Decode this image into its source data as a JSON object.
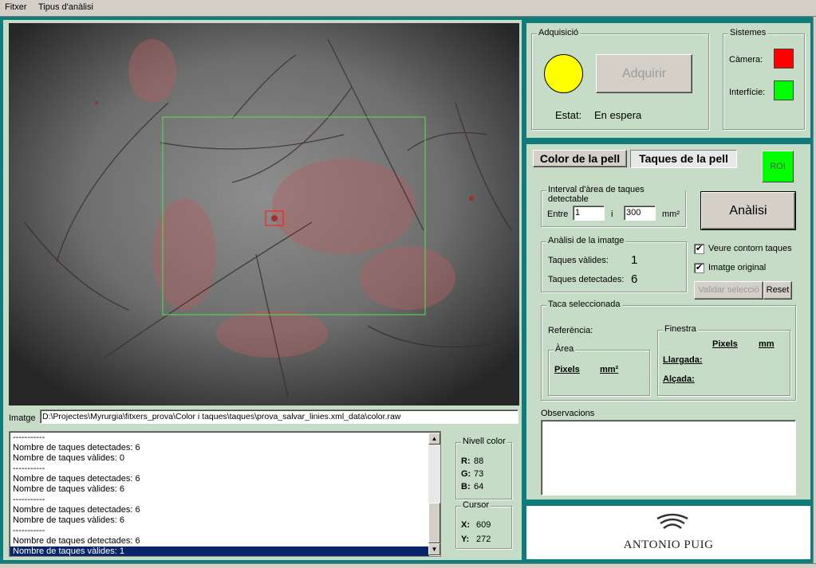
{
  "menu": {
    "file": "Fitxer",
    "analysis": "Tipus d'anàlisi"
  },
  "image_path_label": "Imatge",
  "image_path": "D:\\Projectes\\Myrurgia\\fitxers_prova\\Color i taques\\taques\\prova_salvar_linies.xml_data\\color.raw",
  "log": [
    "-----------",
    "Nombre de taques detectades: 6",
    "Nombre de taques vàlides: 0",
    "-----------",
    "Nombre de taques detectades: 6",
    "Nombre de taques vàlides: 6",
    "-----------",
    "Nombre de taques detectades: 6",
    "Nombre de taques vàlides: 6",
    "-----------",
    "Nombre de taques detectades: 6",
    "Nombre de taques vàlides: 1"
  ],
  "color_level": {
    "title": "Nivell color",
    "r_label": "R:",
    "r": "88",
    "g_label": "G:",
    "g": "73",
    "b_label": "B:",
    "b": "64"
  },
  "cursor": {
    "title": "Cursor",
    "x_label": "X:",
    "x": "609",
    "y_label": "Y:",
    "y": "272"
  },
  "acquisition": {
    "title": "Adquisició",
    "button": "Adquirir",
    "state_label": "Estat:",
    "state": "En espera",
    "indicator_color": "#ffff00"
  },
  "systems": {
    "title": "Sistemes",
    "camera": "Càmera:",
    "camera_color": "#ff0000",
    "interface": "Interfície:",
    "interface_color": "#00ff00"
  },
  "tabs": {
    "skin_color": "Color de la pell",
    "skin_spots": "Taques de la pell"
  },
  "roi_button": "ROI",
  "interval": {
    "title": "Interval d'àrea de taques detectable",
    "between": "Entre",
    "and": "i",
    "min": "1",
    "max": "300",
    "unit": "mm²"
  },
  "analyze_button": "Anàlisi",
  "image_analysis": {
    "title": "Anàlisi de la imatge",
    "valid_label": "Taques vàlides:",
    "valid": "1",
    "detected_label": "Taques detectades:",
    "detected": "6"
  },
  "options": {
    "show_contour": "Veure contorn taques",
    "original_image": "Imatge original"
  },
  "validate_button": "Validar selecció",
  "reset_button": "Reset",
  "selected_spot": {
    "title": "Taca seleccionada",
    "reference": "Referència:",
    "area_title": "Àrea",
    "pixels": "Pixels",
    "mm2": "mm²",
    "window_title": "Finestra",
    "mm": "mm",
    "length": "Llargada:",
    "height": "Alçada:"
  },
  "observations": "Observacions",
  "logo": "ANTONIO PUIG"
}
